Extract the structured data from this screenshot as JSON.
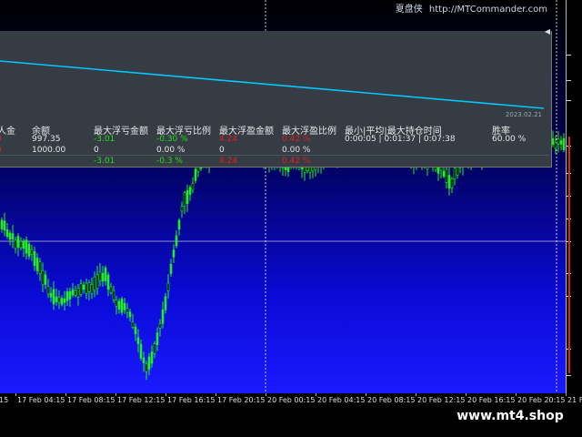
{
  "header": {
    "brand_cn": "夏盘侠",
    "url": "http://MTCommander.com"
  },
  "panel": {
    "date": "2023.02.21",
    "collapse_icon": "triangle-left-icon",
    "columns": [
      {
        "key": "deposit",
        "header": "人金",
        "r1": "0",
        "r2": "0"
      },
      {
        "key": "balance",
        "header": "余额",
        "r1": "997.35",
        "r2": "1000.00"
      },
      {
        "key": "max_float_loss_amount",
        "header": "最大浮亏金额",
        "r1": "-3.01",
        "r2": "0",
        "r3": "-3.01"
      },
      {
        "key": "max_float_loss_pct",
        "header": "最大浮亏比例",
        "r1": "-0.30 %",
        "r2": "0.00 %",
        "r3": "-0.3 %"
      },
      {
        "key": "max_float_profit_amount",
        "header": "最大浮盈金额",
        "r1": "4.24",
        "r2": "0",
        "r3": "4.24"
      },
      {
        "key": "max_float_profit_pct",
        "header": "最大浮盈比例",
        "r1": "0.42 %",
        "r2": "0.00 %",
        "r3": "0.42 %"
      },
      {
        "key": "hold_time",
        "header": "最小|平均|最大持仓时间",
        "r1": "0:00:05 | 0:01:37 | 0:07:38"
      },
      {
        "key": "win_rate",
        "header": "胜率",
        "r1": "60.00 %"
      }
    ]
  },
  "time_axis": {
    "labels": [
      "15",
      "17 Feb 04:15",
      "17 Feb 08:15",
      "17 Feb 12:15",
      "17 Feb 16:15",
      "17 Feb 20:15",
      "20 Feb 00:15",
      "20 Feb 04:15",
      "20 Feb 08:15",
      "20 Feb 12:15",
      "20 Feb 16:15",
      "20 Feb 20:15",
      "21 Fe"
    ]
  },
  "watermark": "www.mt4.shop",
  "colors": {
    "bull": "#22ee22",
    "equity_line": "#00c8ff",
    "loss": "#e02020",
    "gain": "#22dd22"
  }
}
